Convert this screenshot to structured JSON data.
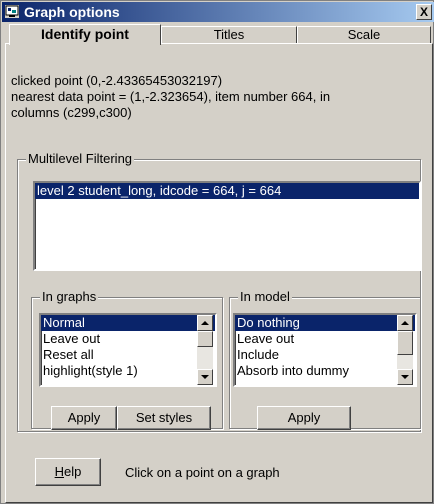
{
  "window": {
    "title": "Graph options",
    "close_label": "X"
  },
  "tabs": [
    {
      "label": "Identify point"
    },
    {
      "label": "Titles"
    },
    {
      "label": "Scale"
    }
  ],
  "info": {
    "line1": "clicked point (0,-2.43365453032197)",
    "line2": "nearest data point = (1,-2.323654), item number 664, in",
    "line3": "columns (c299,c300)"
  },
  "multilevel": {
    "title": "Multilevel Filtering",
    "items": [
      "level 2  student_long, idcode = 664,    j = 664"
    ]
  },
  "in_graphs": {
    "title": "In graphs",
    "items": [
      "Normal",
      "Leave out",
      "Reset all",
      "highlight(style 1)"
    ],
    "apply_label": "Apply",
    "set_styles_label": "Set styles"
  },
  "in_model": {
    "title": "In model",
    "items": [
      "Do nothing",
      "Leave out",
      "Include",
      "Absorb into dummy"
    ],
    "apply_label": "Apply"
  },
  "footer": {
    "help_label": "Help",
    "status": "Click on a point on a graph"
  }
}
